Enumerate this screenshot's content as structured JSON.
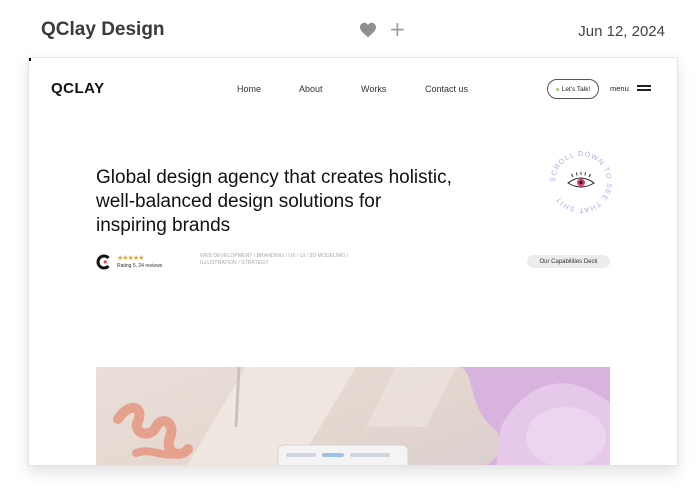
{
  "card": {
    "title": "QClay Design",
    "date": "Jun 12, 2024",
    "icons": [
      "heart-icon",
      "plus-icon"
    ]
  },
  "site": {
    "logo": "QCLAY",
    "nav": [
      "Home",
      "About",
      "Works",
      "Contact us"
    ],
    "talk_button": "Let's Talk!",
    "menu_label": "menu",
    "hero_title": "Global design agency that creates holistic, well-balanced design solutions for inspiring brands",
    "badge_text": "SCROLL DOWN TO SEE THAT SHIT",
    "rating": {
      "stars": "★★★★★",
      "text": "Rating 5, 24 reviews"
    },
    "services": "WEB DEVELOPMENT / BRANDING / UX / UI / 3D MODELING / ILLUSTRATION / STRATEGY",
    "capabilities_button": "Our Capabilities Deck"
  },
  "colors": {
    "accent_green": "#9ad36a",
    "stars": "#e9a623",
    "badge_lavender": "#b9a9e6"
  }
}
